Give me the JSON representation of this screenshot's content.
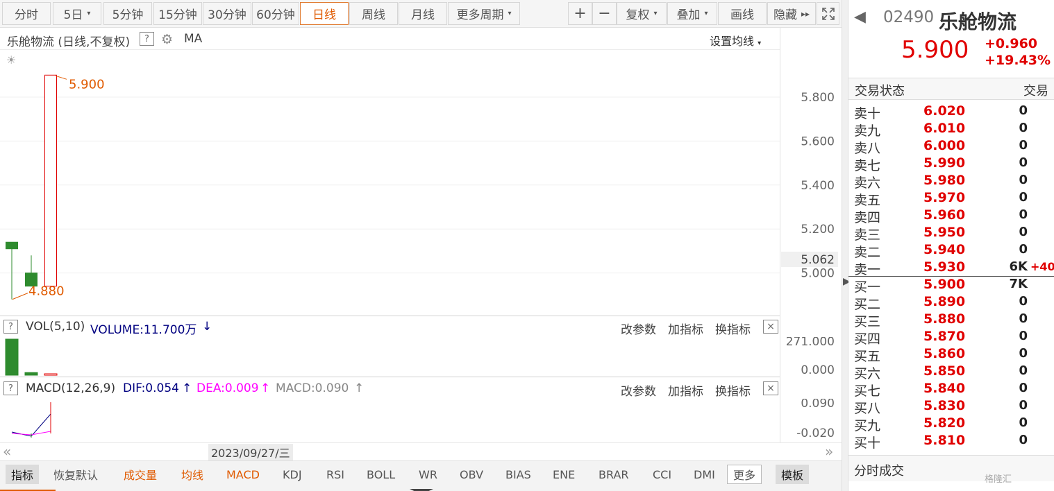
{
  "toolbar": {
    "periods": [
      "分时",
      "5日",
      "5分钟",
      "15分钟",
      "30分钟",
      "60分钟",
      "日线",
      "周线",
      "月线",
      "更多周期"
    ],
    "active_period": "日线",
    "actions": {
      "zoom_in": "+",
      "zoom_out": "−",
      "fuquan": "复权",
      "overlay": "叠加",
      "draw": "画线",
      "hide": "隐藏"
    }
  },
  "chart": {
    "title": "乐舱物流 (日线,不复权)",
    "help": "?",
    "indicator": "MA",
    "set_ma": "设置均线",
    "y_ticks": [
      "5.800",
      "5.600",
      "5.400",
      "5.200",
      "5.000"
    ],
    "current_price_label": "5.062",
    "high_label": "5.900",
    "low_label": "4.880"
  },
  "chart_data": {
    "type": "candlestick",
    "candles": [
      {
        "open": 5.14,
        "close": 5.11,
        "high": 5.14,
        "low": 4.88
      },
      {
        "open": 5.0,
        "close": 4.94,
        "high": 5.08,
        "low": 4.94
      },
      {
        "open": 4.94,
        "close": 5.9,
        "high": 5.9,
        "low": 4.94
      }
    ],
    "volume": [
      271,
      20,
      8
    ],
    "volume_ticks": [
      "271.000",
      "0.000"
    ],
    "macd_ticks": [
      "0.090",
      "-0.020"
    ],
    "y_range": [
      4.8,
      6.0
    ]
  },
  "vol_panel": {
    "title": "VOL(5,10)",
    "value": "VOLUME:11.700万",
    "arrow": "↓",
    "actions": [
      "改参数",
      "加指标",
      "换指标"
    ],
    "close": "×"
  },
  "macd_panel": {
    "title": "MACD(12,26,9)",
    "dif": "DIF:0.054",
    "dea": "DEA:0.009",
    "macd": "MACD:0.090",
    "arrow": "↑",
    "actions": [
      "改参数",
      "加指标",
      "换指标"
    ],
    "close": "×"
  },
  "date_bar": {
    "date": "2023/09/27/三",
    "left": "«",
    "right": "»"
  },
  "bottom_tabs": [
    "指标",
    "恢复默认",
    "成交量",
    "均线",
    "MACD",
    "KDJ",
    "RSI",
    "BOLL",
    "WR",
    "OBV",
    "BIAS",
    "ENE",
    "BRAR",
    "CCI",
    "DMI",
    "更多",
    "模板"
  ],
  "quote": {
    "back": "◀",
    "code": "02490",
    "name": "乐舱物流",
    "price": "5.900",
    "change": "+0.960",
    "change_pct": "+19.43%",
    "status_label": "交易状态",
    "status_label2": "交易",
    "asks": [
      {
        "label": "卖十",
        "price": "6.020",
        "vol": "0"
      },
      {
        "label": "卖九",
        "price": "6.010",
        "vol": "0"
      },
      {
        "label": "卖八",
        "price": "6.000",
        "vol": "0"
      },
      {
        "label": "卖七",
        "price": "5.990",
        "vol": "0"
      },
      {
        "label": "卖六",
        "price": "5.980",
        "vol": "0"
      },
      {
        "label": "卖五",
        "price": "5.970",
        "vol": "0"
      },
      {
        "label": "卖四",
        "price": "5.960",
        "vol": "0"
      },
      {
        "label": "卖三",
        "price": "5.950",
        "vol": "0"
      },
      {
        "label": "卖二",
        "price": "5.940",
        "vol": "0"
      },
      {
        "label": "卖一",
        "price": "5.930",
        "vol": "6K",
        "delta": "+40"
      }
    ],
    "bids": [
      {
        "label": "买一",
        "price": "5.900",
        "vol": "7K"
      },
      {
        "label": "买二",
        "price": "5.890",
        "vol": "0"
      },
      {
        "label": "买三",
        "price": "5.880",
        "vol": "0"
      },
      {
        "label": "买四",
        "price": "5.870",
        "vol": "0"
      },
      {
        "label": "买五",
        "price": "5.860",
        "vol": "0"
      },
      {
        "label": "买六",
        "price": "5.850",
        "vol": "0"
      },
      {
        "label": "买七",
        "price": "5.840",
        "vol": "0"
      },
      {
        "label": "买八",
        "price": "5.830",
        "vol": "0"
      },
      {
        "label": "买九",
        "price": "5.820",
        "vol": "0"
      },
      {
        "label": "买十",
        "price": "5.810",
        "vol": "0"
      }
    ],
    "ticks_title": "分时成交",
    "watermark": "格隆汇"
  },
  "colors": {
    "up": "#e00000",
    "down": "#2e8b2e",
    "accent": "#e05a00",
    "dif": "#000080",
    "dea": "#ff00ff"
  }
}
